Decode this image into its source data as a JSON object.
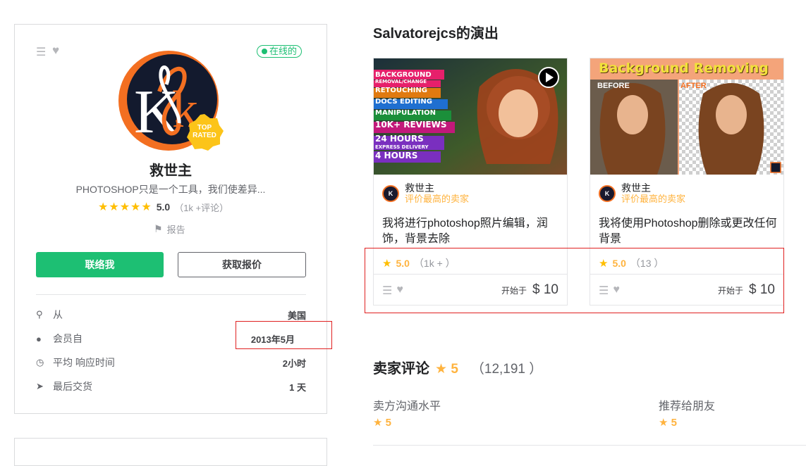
{
  "profile": {
    "online_label": "在线的",
    "name": "救世主",
    "tagline": "PHOTOSHOP只是一个工具，我们使差异...",
    "badge_line1": "TOP",
    "badge_line2": "RATED",
    "stars": "★★★★★",
    "rating": "5.0",
    "rating_count": "（1k +评论）",
    "report_label": "报告",
    "contact_button": "联络我",
    "quote_button": "获取报价",
    "stats": [
      {
        "label": "从",
        "value": "美国",
        "icon": "location-pin-icon"
      },
      {
        "label": "会员自",
        "value": "2013年5月",
        "icon": "user-icon"
      },
      {
        "label": "平均 响应时间",
        "value": "2小时",
        "icon": "clock-icon"
      },
      {
        "label": "最后交货",
        "value": "1 天",
        "icon": "paper-plane-icon"
      }
    ]
  },
  "gigs_section": {
    "title": "Salvatorejcs的演出",
    "gigs": [
      {
        "seller_name": "救世主",
        "seller_level": "评价最高的卖家",
        "title": "我将进行photoshop照片编辑，润饰，背景去除",
        "rating": "5.0",
        "rating_count": "（1k + ）",
        "price_prefix": "开始于",
        "price": "$ 10",
        "banner_lines": [
          "BACKGROUND",
          "REMOVAL/CHANGE",
          "RETOUCHING",
          "DOCS EDITING",
          "MANIPULATION",
          "10K+ REVIEWS",
          "24 HOURS",
          "EXPRESS DELIVERY",
          "4 HOURS"
        ]
      },
      {
        "seller_name": "救世主",
        "seller_level": "评价最高的卖家",
        "title": "我将使用Photoshop删除或更改任何背景",
        "rating": "5.0",
        "rating_count": "（13 ）",
        "price_prefix": "开始于",
        "price": "$ 10",
        "banner_title": "Background Removing",
        "before_label": "BEFORE",
        "after_label": "AFTER"
      }
    ]
  },
  "reviews": {
    "title": "卖家评论",
    "score": "5",
    "count": "（12,191 ）",
    "sub_ratings": [
      {
        "label": "卖方沟通水平",
        "value": "5"
      },
      {
        "label": "推荐给朋友",
        "value": "5"
      }
    ]
  },
  "colors": {
    "accent_green": "#1dbf73",
    "star_yellow": "#ffbe00",
    "level_orange": "#ffb33e",
    "highlight_red": "#e02020"
  }
}
